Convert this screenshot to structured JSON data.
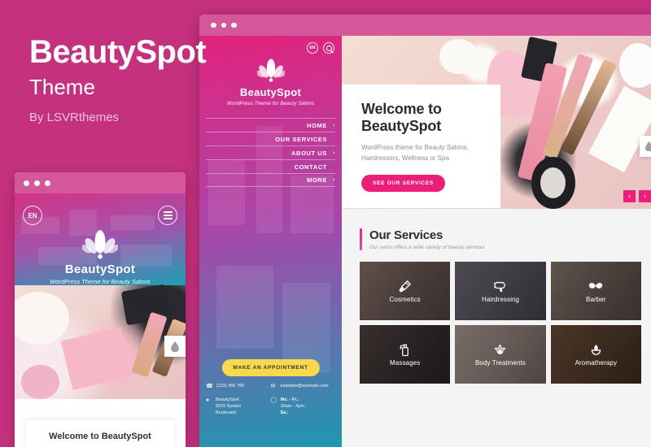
{
  "promo": {
    "title": "BeautySpot",
    "subtitle": "Theme",
    "author": "By LSVRthemes"
  },
  "colors": {
    "background": "#c4317f",
    "accent_pink": "#ed1e79",
    "chrome": "#d4579a",
    "appointment_yellow": "#f7d94e",
    "section_gray": "#f4f4f5"
  },
  "mobile": {
    "lang_badge": "EN",
    "menu_icon": "hamburger-icon",
    "logo_icon": "lotus-icon",
    "brand": "BeautySpot",
    "tagline": "WordPress Theme for Beauty Salons",
    "droplet_icon": "droplet-icon",
    "card_title": "Welcome to BeautySpot"
  },
  "desktop": {
    "sidebar": {
      "lang_badge": "EN",
      "search_icon": "search-icon",
      "logo_icon": "lotus-icon",
      "brand": "BeautySpot",
      "tagline": "WordPress Theme for Beauty Salons",
      "nav": [
        {
          "label": "HOME",
          "chevron": "›"
        },
        {
          "label": "OUR SERVICES",
          "chevron": ""
        },
        {
          "label": "ABOUT US",
          "chevron": "›"
        },
        {
          "label": "CONTACT",
          "chevron": ""
        },
        {
          "label": "MORE",
          "chevron": "›"
        }
      ],
      "appointment_button": "MAKE AN APPOINTMENT",
      "contact": [
        {
          "icon": "phone-icon",
          "line1": "(123) 456 789",
          "line2": "",
          "line3": ""
        },
        {
          "icon": "mail-icon",
          "line1": "example@example.c",
          "line2": "om",
          "line3": ""
        },
        {
          "icon": "pin-icon",
          "line1": "BeautySpot",
          "line2": "9015 Sunset",
          "line3": "Boulevard"
        },
        {
          "icon": "clock-icon",
          "line1": "Mo. - Fr.:",
          "line2": "10am - 4pm",
          "line3": "Sa.:"
        }
      ]
    },
    "hero": {
      "heading": "Welcome to BeautySpot",
      "paragraph": "WordPress theme for Beauty Salons, Hairdressers, Wellness or Spa",
      "button": "SEE OUR SERVICES",
      "prev_icon": "‹",
      "next_icon": "›",
      "droplet_icon": "droplet-icon"
    },
    "services": {
      "heading": "Our Services",
      "subheading": "Our salon offers a wide variety of beauty services",
      "tiles": [
        {
          "label": "Cosmetics",
          "icon": "makeup-brush-icon"
        },
        {
          "label": "Hairdressing",
          "icon": "hairdryer-icon"
        },
        {
          "label": "Barber",
          "icon": "mustache-icon"
        },
        {
          "label": "Massages",
          "icon": "lotion-bottle-icon"
        },
        {
          "label": "Body Treatments",
          "icon": "lotus-icon"
        },
        {
          "label": "Aromatherapy",
          "icon": "oil-burner-icon"
        }
      ]
    }
  }
}
